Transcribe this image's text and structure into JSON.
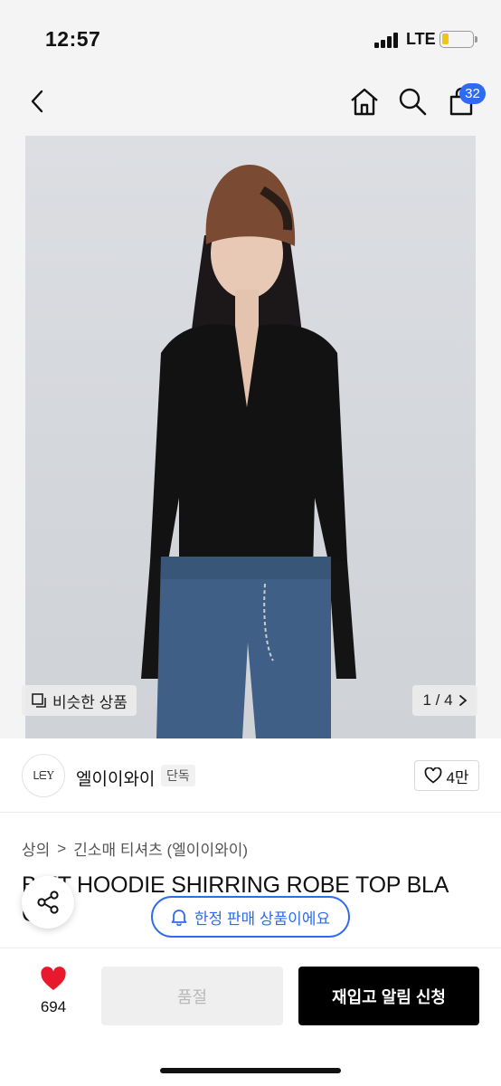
{
  "status_bar": {
    "time": "12:57",
    "network": "LTE"
  },
  "nav": {
    "cart_count": "32",
    "icons": [
      "back-icon",
      "home-icon",
      "search-icon",
      "shopping-bag-icon"
    ]
  },
  "gallery": {
    "similar_label": "비슷한 상품",
    "pager": "1 / 4"
  },
  "brand": {
    "logo_text": "ᒪᗴY",
    "name": "엘이이와이",
    "badge": "단독",
    "like_count": "4만"
  },
  "breadcrumb": {
    "level1": "상의",
    "separator": ">",
    "level2": "긴소매 티셔츠 (엘이이와이)"
  },
  "product": {
    "title": "B  ET HOODIE SHIRRING ROBE TOP BLA",
    "title_line2": "C"
  },
  "notice": {
    "limited_label": "한정 판매 상품이에요"
  },
  "bottom_bar": {
    "wish_count": "694",
    "soldout_label": "품절",
    "restock_label": "재입고 알림 신청"
  },
  "colors": {
    "accent": "#2f6bf0",
    "heart": "#e8192c",
    "primary_button": "#000000"
  }
}
